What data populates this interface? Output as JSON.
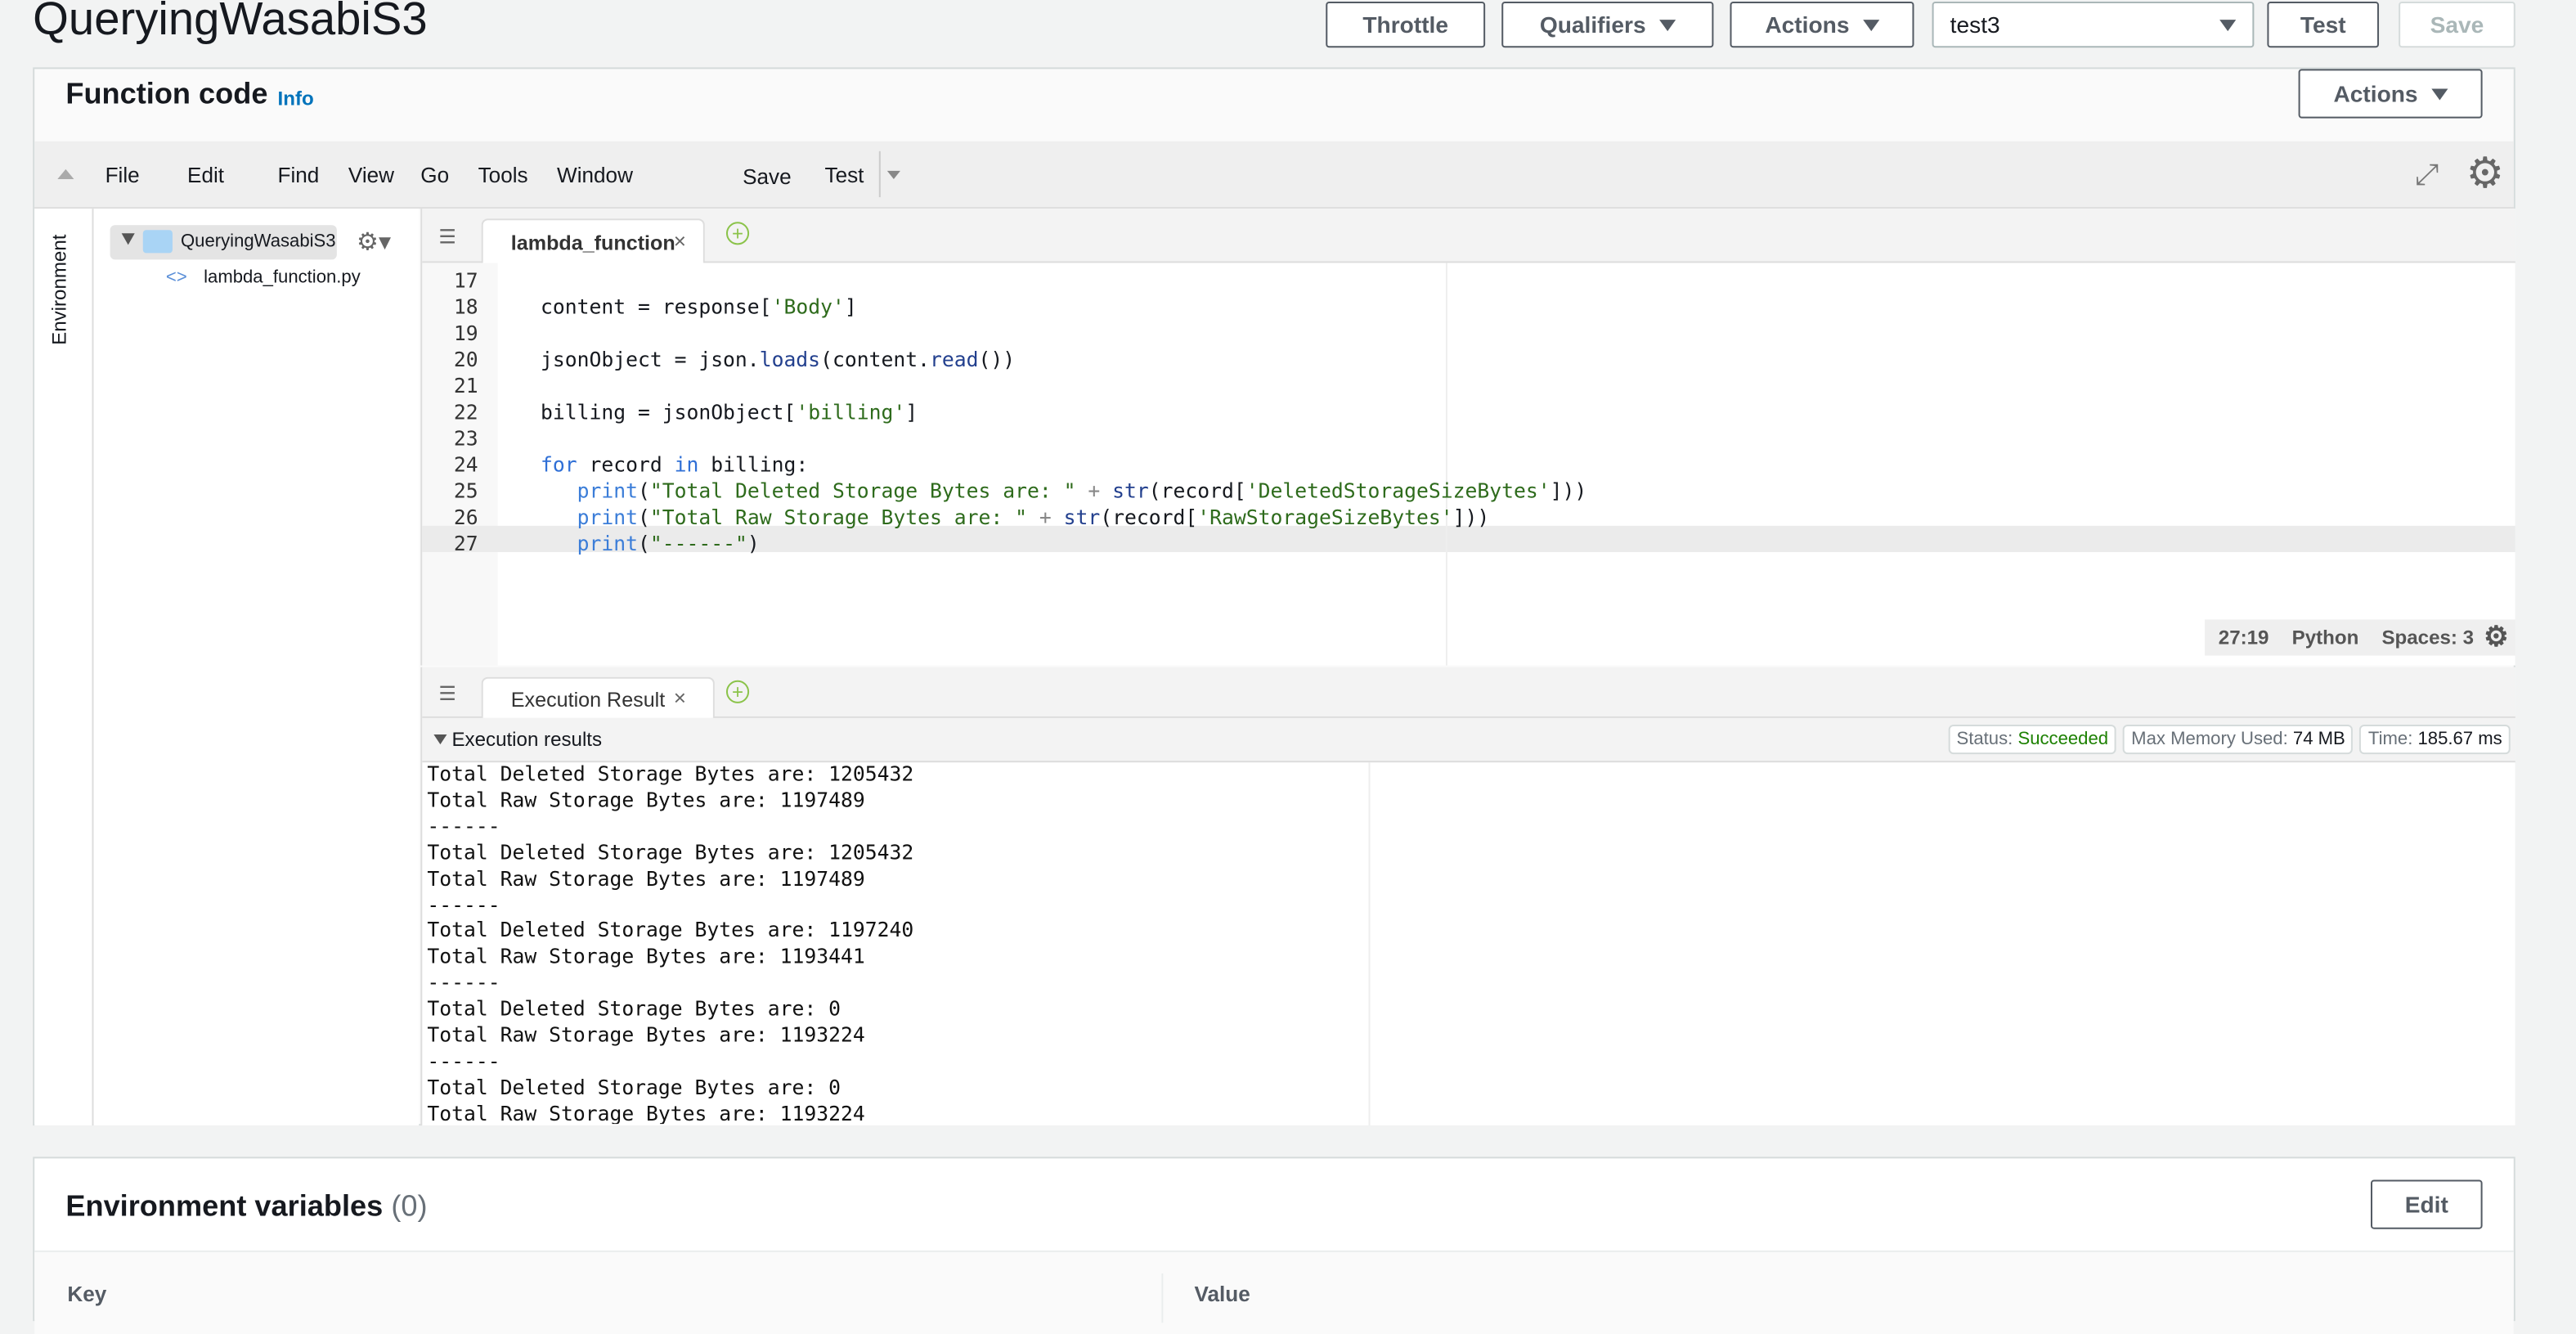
{
  "header": {
    "title": "QueryingWasabiS3",
    "buttons": {
      "throttle": "Throttle",
      "qualifiers": "Qualifiers",
      "actions": "Actions",
      "test_event": "test3",
      "test": "Test",
      "save": "Save"
    }
  },
  "function_code": {
    "title": "Function code",
    "info": "Info",
    "actions": "Actions",
    "menu": [
      "File",
      "Edit",
      "Find",
      "View",
      "Go",
      "Tools",
      "Window"
    ],
    "save": "Save",
    "test": "Test",
    "env_tab": "Environment",
    "folder": "QueryingWasabiS3",
    "file": "lambda_function.py",
    "editor_tab": "lambda_function",
    "code_lines": [
      {
        "n": "17",
        "tokens": []
      },
      {
        "n": "18",
        "tokens": [
          {
            "t": "content = response[",
            "c": ""
          },
          {
            "t": "'Body'",
            "c": "s"
          },
          {
            "t": "]",
            "c": ""
          }
        ]
      },
      {
        "n": "19",
        "tokens": []
      },
      {
        "n": "20",
        "tokens": [
          {
            "t": "jsonObject = json.",
            "c": ""
          },
          {
            "t": "loads",
            "c": "m"
          },
          {
            "t": "(content.",
            "c": ""
          },
          {
            "t": "read",
            "c": "m"
          },
          {
            "t": "())",
            "c": ""
          }
        ]
      },
      {
        "n": "21",
        "tokens": []
      },
      {
        "n": "22",
        "tokens": [
          {
            "t": "billing = jsonObject[",
            "c": ""
          },
          {
            "t": "'billing'",
            "c": "s"
          },
          {
            "t": "]",
            "c": ""
          }
        ]
      },
      {
        "n": "23",
        "tokens": []
      },
      {
        "n": "24",
        "tokens": [
          {
            "t": "for",
            "c": "k"
          },
          {
            "t": " record ",
            "c": ""
          },
          {
            "t": "in",
            "c": "k"
          },
          {
            "t": " billing:",
            "c": ""
          }
        ]
      },
      {
        "n": "25",
        "tokens": [
          {
            "t": "   ",
            "c": ""
          },
          {
            "t": "print",
            "c": "f"
          },
          {
            "t": "(",
            "c": ""
          },
          {
            "t": "\"Total Deleted Storage Bytes are: \"",
            "c": "s"
          },
          {
            "t": " + ",
            "c": "o"
          },
          {
            "t": "str",
            "c": "m"
          },
          {
            "t": "(record[",
            "c": ""
          },
          {
            "t": "'DeletedStorageSizeBytes'",
            "c": "s"
          },
          {
            "t": "]))",
            "c": ""
          }
        ]
      },
      {
        "n": "26",
        "tokens": [
          {
            "t": "   ",
            "c": ""
          },
          {
            "t": "print",
            "c": "f"
          },
          {
            "t": "(",
            "c": ""
          },
          {
            "t": "\"Total Raw Storage Bytes are: \"",
            "c": "s"
          },
          {
            "t": " + ",
            "c": "o"
          },
          {
            "t": "str",
            "c": "m"
          },
          {
            "t": "(record[",
            "c": ""
          },
          {
            "t": "'RawStorageSizeBytes'",
            "c": "s"
          },
          {
            "t": "]))",
            "c": ""
          }
        ]
      },
      {
        "n": "27",
        "tokens": [
          {
            "t": "   ",
            "c": ""
          },
          {
            "t": "print",
            "c": "f"
          },
          {
            "t": "(",
            "c": ""
          },
          {
            "t": "\"------\"",
            "c": "s"
          },
          {
            "t": ")",
            "c": ""
          }
        ]
      }
    ],
    "status_bar": {
      "cursor": "27:19",
      "language": "Python",
      "spaces": "Spaces: 3"
    },
    "result_tab": "Execution Result",
    "results_label": "Execution results",
    "status": {
      "label": "Status:",
      "value": "Succeeded",
      "mem_label": "Max Memory Used:",
      "mem": "74 MB",
      "time_label": "Time:",
      "time": "185.67 ms"
    },
    "output": [
      "Total Deleted Storage Bytes are: 1205432",
      "Total Raw Storage Bytes are: 1197489",
      "------",
      "Total Deleted Storage Bytes are: 1205432",
      "Total Raw Storage Bytes are: 1197489",
      "------",
      "Total Deleted Storage Bytes are: 1197240",
      "Total Raw Storage Bytes are: 1193441",
      "------",
      "Total Deleted Storage Bytes are: 0",
      "Total Raw Storage Bytes are: 1193224",
      "------",
      "Total Deleted Storage Bytes are: 0",
      "Total Raw Storage Bytes are: 1193224"
    ]
  },
  "env_vars": {
    "title": "Environment variables",
    "count": "(0)",
    "edit": "Edit",
    "col_key": "Key",
    "col_value": "Value"
  },
  "colors": {
    "accent": "#0073bb",
    "success": "#1d8102"
  }
}
